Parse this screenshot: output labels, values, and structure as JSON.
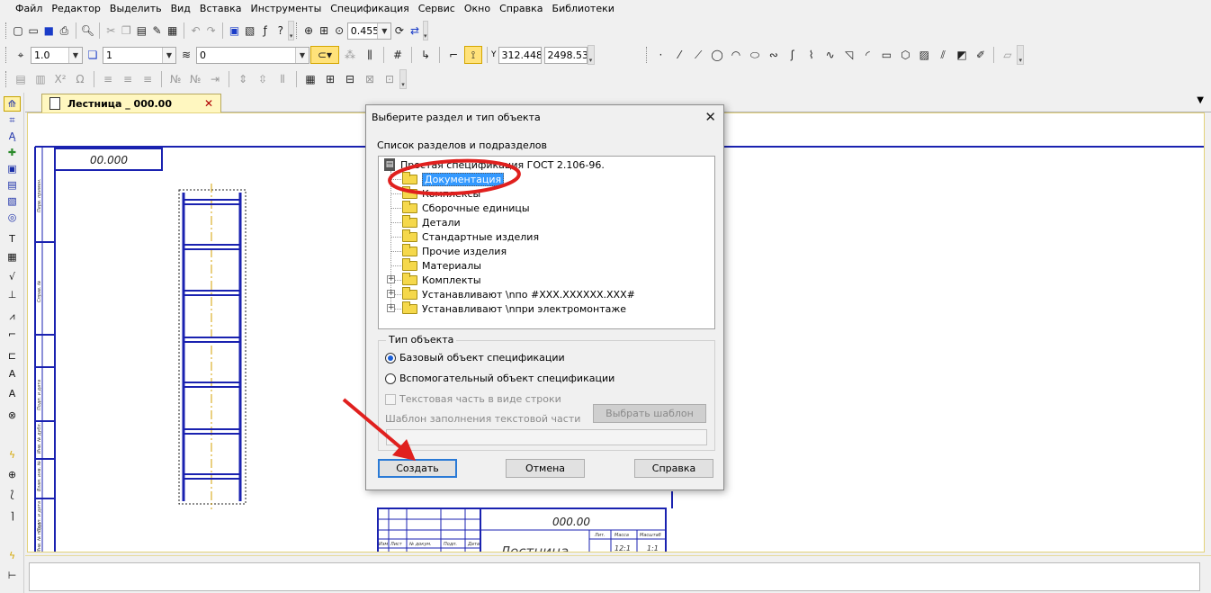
{
  "menu": [
    "Файл",
    "Редактор",
    "Выделить",
    "Вид",
    "Вставка",
    "Инструменты",
    "Спецификация",
    "Сервис",
    "Окно",
    "Справка",
    "Библиотеки"
  ],
  "toolbar": {
    "zoom_value": "0.4553",
    "scale_value": "1.0",
    "layer_value": "1",
    "style_value": "0",
    "coord_x": "312.448",
    "coord_y": "2498.53",
    "coord_y_label": "Y"
  },
  "tab": {
    "title": "Лестница _ 000.00",
    "close": "✕"
  },
  "drawing": {
    "stamp_top": "00.000",
    "stamp_bottom": "000.00",
    "title_text": "Лестница",
    "col_labels": [
      "Изм",
      "Лист",
      "№ докум.",
      "Подп.",
      "Дата"
    ],
    "lit_labels": [
      "Лит.",
      "Масса",
      "Масштаб"
    ],
    "scale_vals": [
      "12:1",
      "1:1"
    ],
    "left_strip": [
      "Перв. примен.",
      "Справ. №",
      "Подп. и дата",
      "Инв. № дубл.",
      "Взам. инв. №",
      "Подп. и дата",
      "Инв. № подл."
    ]
  },
  "dialog": {
    "title": "Выберите раздел и тип объекта",
    "close": "✕",
    "list_label": "Список разделов и подразделов",
    "root": "Простая спецификация ГОСТ 2.106-96.",
    "items": [
      {
        "label": "Документация",
        "selected": true,
        "expandable": false
      },
      {
        "label": "Комплексы",
        "selected": false,
        "expandable": false
      },
      {
        "label": "Сборочные единицы",
        "selected": false,
        "expandable": false
      },
      {
        "label": "Детали",
        "selected": false,
        "expandable": false
      },
      {
        "label": "Стандартные изделия",
        "selected": false,
        "expandable": false
      },
      {
        "label": "Прочие изделия",
        "selected": false,
        "expandable": false
      },
      {
        "label": "Материалы",
        "selected": false,
        "expandable": false
      },
      {
        "label": "Комплекты",
        "selected": false,
        "expandable": true
      },
      {
        "label": "Устанавливают \\nпо #XXX.XXXXXX.XXX#",
        "selected": false,
        "expandable": true
      },
      {
        "label": "Устанавливают \\nпри электромонтаже",
        "selected": false,
        "expandable": true
      }
    ],
    "type_group": "Тип объекта",
    "radio_base": "Базовый объект спецификации",
    "radio_aux": "Вспомогательный объект спецификации",
    "checkbox_text": "Текстовая часть в виде строки",
    "template_label": "Шаблон заполнения текстовой части",
    "choose_template": "Выбрать шаблон",
    "create": "Создать",
    "cancel": "Отмена",
    "help": "Справка"
  },
  "annotation_color": "#e0201e",
  "drawing_color": "#1a22b0"
}
